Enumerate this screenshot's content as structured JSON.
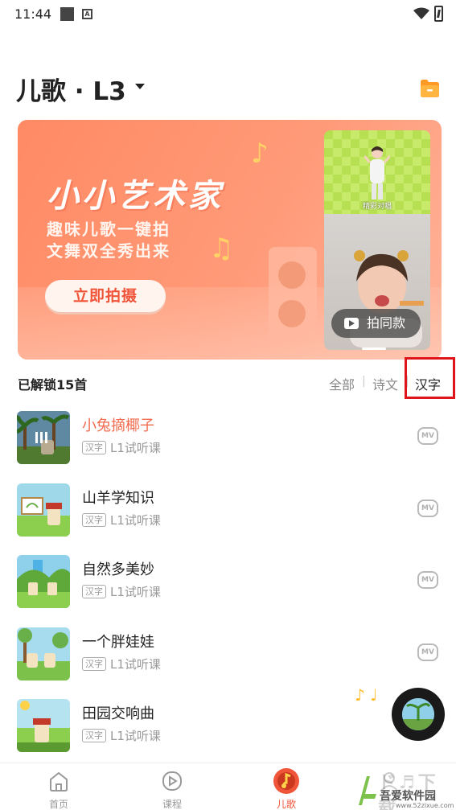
{
  "status_bar": {
    "time": "11:44"
  },
  "header": {
    "title": "儿歌 · L3"
  },
  "banner": {
    "title": "小小艺术家",
    "subtitle_line1": "趣味儿歌一键拍",
    "subtitle_line2": "文舞双全秀出来",
    "cta_label": "立即拍摄",
    "video_caption": "精彩对唱",
    "shoot_same_label": "拍同款"
  },
  "list_header": {
    "unlocked": "已解锁15首",
    "filters": [
      "全部",
      "诗文",
      "汉字"
    ],
    "selected_filter": "汉字"
  },
  "songs": [
    {
      "name": "小兔摘椰子",
      "tag": "汉字",
      "level": "L1试听课",
      "mv": "MV",
      "playing": true
    },
    {
      "name": "山羊学知识",
      "tag": "汉字",
      "level": "L1试听课",
      "mv": "MV"
    },
    {
      "name": "自然多美妙",
      "tag": "汉字",
      "level": "L1试听课",
      "mv": "MV"
    },
    {
      "name": "一个胖娃娃",
      "tag": "汉字",
      "level": "L1试听课",
      "mv": "MV"
    },
    {
      "name": "田园交响曲",
      "tag": "汉字",
      "level": "L1试听课",
      "mv": "MV"
    }
  ],
  "bottom_nav": [
    {
      "label": "首页",
      "icon": "home-icon"
    },
    {
      "label": "课程",
      "icon": "play-circle-icon"
    },
    {
      "label": "儿歌",
      "icon": "music-disc-icon",
      "active": true
    },
    {
      "label": "我的",
      "icon": "user-icon"
    }
  ],
  "watermark": {
    "text": "吾爱软件园",
    "url": "www.52zixue.com"
  },
  "colors": {
    "accent": "#f0553a",
    "banner": "#ff8a64",
    "highlight_box": "#e0151b"
  }
}
